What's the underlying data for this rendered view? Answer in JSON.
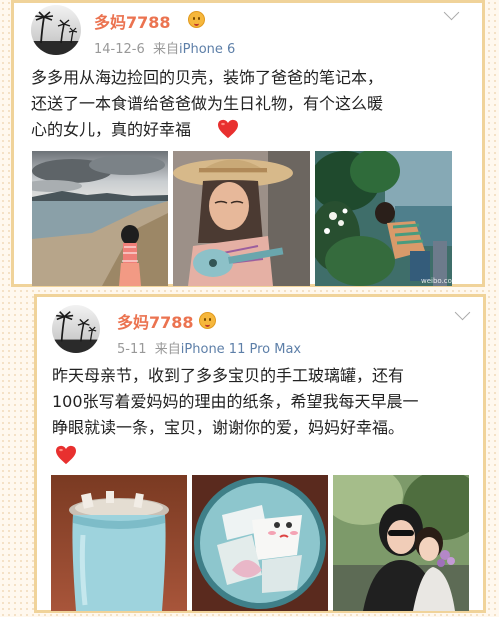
{
  "posts": [
    {
      "username": "多妈7788",
      "date": "14-12-6",
      "source_prefix": "来自",
      "source": "iPhone 6",
      "text_line1": "多多用从海边捡回的贝壳，装饰了爸爸的笔记本，",
      "text_line2": "还送了一本食谱给爸爸做为生日礼物，有个这么暖",
      "text_line3": "心的女儿，真的好幸福",
      "photo_watermark": "weibo.com/u/51"
    },
    {
      "username": "多妈7788",
      "date": "5-11",
      "source_prefix": "来自",
      "source": "iPhone 11 Pro Max",
      "text_line1": "昨天母亲节，收到了多多宝贝的手工玻璃罐，还有",
      "text_line2": "100张写着爱妈妈的理由的纸条，希望我每天早晨一",
      "text_line3": "睁眼就读一条，宝贝，谢谢你的爱，妈妈好幸福。"
    }
  ],
  "icons": {
    "vip_badge": "vip-smiley-icon",
    "more": "chevron-down-icon",
    "heart": "red-heart-icon"
  },
  "colors": {
    "username": "#eb7350",
    "source_link": "#5d7fa8",
    "card_border": "#f0d39a",
    "heart": "#e8302f"
  }
}
